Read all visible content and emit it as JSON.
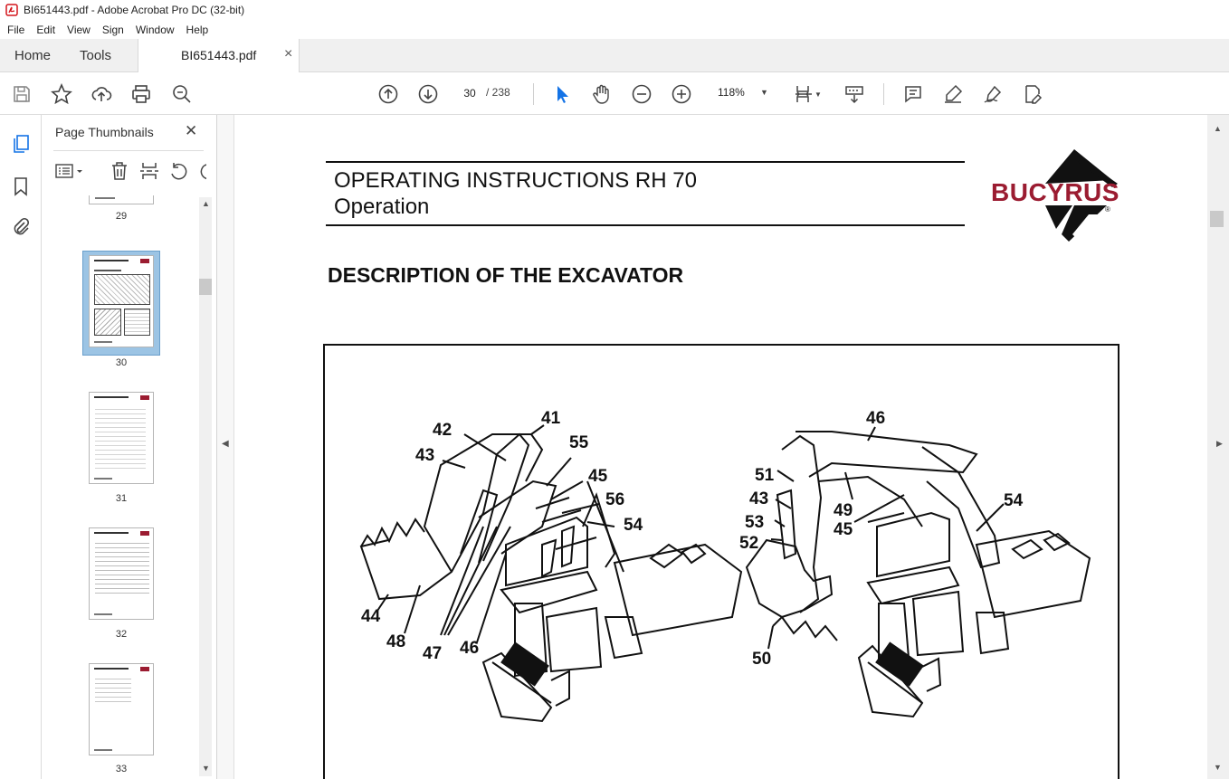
{
  "window": {
    "title": "BI651443.pdf - Adobe Acrobat Pro DC (32-bit)"
  },
  "menu": [
    "File",
    "Edit",
    "View",
    "Sign",
    "Window",
    "Help"
  ],
  "tabs": {
    "home": "Home",
    "tools": "Tools",
    "document": "BI651443.pdf",
    "close": "×"
  },
  "toolbar": {
    "page_current": "30",
    "page_total": "/ 238",
    "zoom": "118%",
    "icons": [
      "save-icon",
      "star-icon",
      "upload-icon",
      "print-icon",
      "zoom-search-icon",
      "prev-page-icon",
      "next-page-icon",
      "select-arrow-icon",
      "hand-icon",
      "zoom-out-icon",
      "zoom-in-icon",
      "fit-page-icon",
      "scroll-mode-icon",
      "comment-icon",
      "highlight-icon",
      "sign-icon",
      "edit-pdf-icon"
    ]
  },
  "sidebar": {
    "title": "Page Thumbnails",
    "close": "✕",
    "thumbnails": [
      {
        "label": "29"
      },
      {
        "label": "30",
        "selected": true
      },
      {
        "label": "31"
      },
      {
        "label": "32"
      },
      {
        "label": "33"
      }
    ]
  },
  "document": {
    "title_line1": "OPERATING INSTRUCTIONS RH 70",
    "title_line2": "Operation",
    "logo_text": "BUCYRUS",
    "logo_mark": "®",
    "heading": "DESCRIPTION OF THE EXCAVATOR",
    "callouts_left": [
      "41",
      "42",
      "43",
      "55",
      "45",
      "56",
      "54",
      "44",
      "48",
      "47",
      "46"
    ],
    "callouts_right": [
      "46",
      "51",
      "43",
      "49",
      "54",
      "53",
      "45",
      "52",
      "50"
    ]
  },
  "colors": {
    "logo_red": "#9b1c31",
    "acrobat_red": "#d4151b",
    "selected_thumb": "#9cc4e4"
  }
}
